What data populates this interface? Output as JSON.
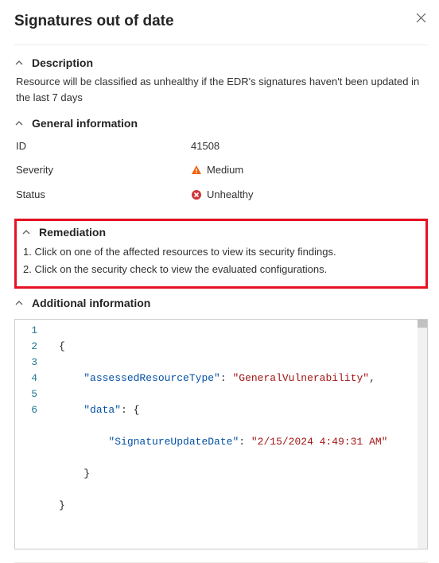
{
  "header": {
    "title": "Signatures out of date"
  },
  "description": {
    "heading": "Description",
    "text": "Resource will be classified as unhealthy if the EDR's signatures haven't been updated in the last 7 days"
  },
  "general": {
    "heading": "General information",
    "id_label": "ID",
    "id_value": "41508",
    "severity_label": "Severity",
    "severity_value": "Medium",
    "status_label": "Status",
    "status_value": "Unhealthy"
  },
  "remediation": {
    "heading": "Remediation",
    "step1": "1. Click on one of the affected resources to view its security findings.",
    "step2": "2. Click on the security check to view the evaluated configurations."
  },
  "additional": {
    "heading": "Additional information",
    "code": {
      "ln1": "1",
      "ln2": "2",
      "ln3": "3",
      "ln4": "4",
      "ln5": "5",
      "ln6": "6",
      "brace_open": "{",
      "brace_close": "}",
      "indent1": "    ",
      "indent2": "        ",
      "k_assessed": "\"assessedResourceType\"",
      "v_assessed": "\"GeneralVulnerability\"",
      "k_data": "\"data\"",
      "k_sig": "\"SignatureUpdateDate\"",
      "v_sig": "\"2/15/2024 4:49:31 AM\"",
      "colon": ": ",
      "comma": ",",
      "open2": " {",
      "close2": "}"
    }
  }
}
